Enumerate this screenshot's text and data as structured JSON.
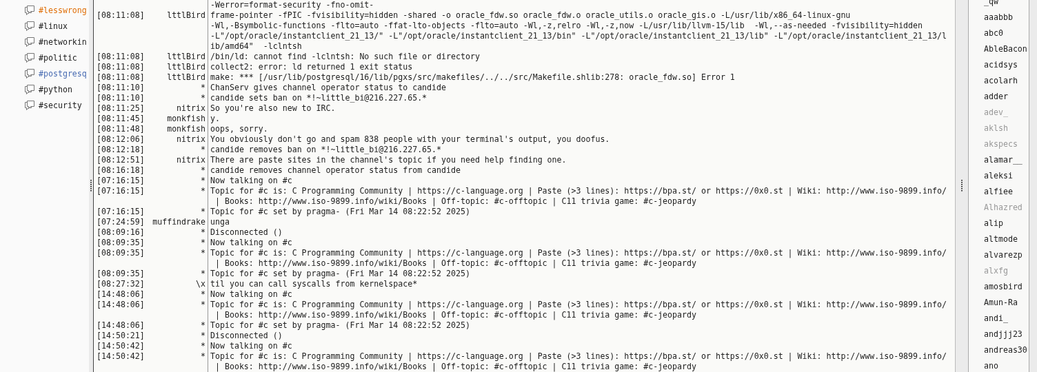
{
  "channels": [
    {
      "name": "#lesswrong",
      "color": "#e0700a"
    },
    {
      "name": "#linux",
      "color": "#222222"
    },
    {
      "name": "#networkin",
      "color": "#222222"
    },
    {
      "name": "#politic",
      "color": "#222222"
    },
    {
      "name": "#postgresq",
      "color": "#4a6db3"
    },
    {
      "name": "#python",
      "color": "#222222"
    },
    {
      "name": "#security",
      "color": "#222222"
    }
  ],
  "log": [
    {
      "lines": [
        "-Werror=format-security -fno-omit-"
      ]
    },
    {
      "time": "[08:11:08]",
      "nick": "lttlBird",
      "lines": [
        "frame-pointer -fPIC -fvisibility=hidden -shared -o oracle_fdw.so oracle_fdw.o oracle_utils.o oracle_gis.o -L/usr/lib/x86_64-linux-gnu",
        "-Wl,-Bsymbolic-functions -flto=auto -ffat-lto-objects -flto=auto -Wl,-z,relro -Wl,-z,now -L/usr/lib/llvm-15/lib  -Wl,--as-needed -fvisibility=hidden",
        "-L\"/opt/oracle/instantclient_21_13/\" -L\"/opt/oracle/instantclient_21_13/bin\" -L\"/opt/oracle/instantclient_21_13/lib\" -L\"/opt/oracle/instantclient_21_13/l",
        "ib/amd64\"  -lclntsh"
      ]
    },
    {
      "time": "[08:11:08]",
      "nick": "lttlBird",
      "lines": [
        "/bin/ld: cannot find -lclntsh: No such file or directory"
      ]
    },
    {
      "time": "[08:11:08]",
      "nick": "lttlBird",
      "lines": [
        "collect2: error: ld returned 1 exit status"
      ]
    },
    {
      "time": "[08:11:08]",
      "nick": "lttlBird",
      "lines": [
        "make: *** [/usr/lib/postgresql/16/lib/pgxs/src/makefiles/../../src/Makefile.shlib:278: oracle_fdw.so] Error 1"
      ]
    },
    {
      "time": "[08:11:10]",
      "nick": "*",
      "lines": [
        "ChanServ gives channel operator status to candide"
      ]
    },
    {
      "time": "[08:11:10]",
      "nick": "*",
      "lines": [
        "candide sets ban on *!~little_bi@216.227.65.*"
      ]
    },
    {
      "time": "[08:11:25]",
      "nick": "nitrix",
      "lines": [
        "So you're also new to IRC."
      ]
    },
    {
      "time": "[08:11:45]",
      "nick": "monkfish",
      "lines": [
        "y."
      ]
    },
    {
      "time": "[08:11:48]",
      "nick": "monkfish",
      "lines": [
        "oops, sorry."
      ]
    },
    {
      "time": "[08:12:06]",
      "nick": "nitrix",
      "lines": [
        "You obviously don't go and spam 838 people with your terminal's output, you doofus."
      ]
    },
    {
      "time": "[08:12:18]",
      "nick": "*",
      "lines": [
        "candide removes ban on *!~little_bi@216.227.65.*"
      ]
    },
    {
      "time": "[08:12:51]",
      "nick": "nitrix",
      "lines": [
        "There are paste sites in the channel's topic if you need help finding one."
      ]
    },
    {
      "time": "[08:16:18]",
      "nick": "*",
      "lines": [
        "candide removes channel operator status from candide"
      ]
    },
    {
      "time": "[07:16:15]",
      "nick": "*",
      "lines": [
        "Now talking on #c"
      ]
    },
    {
      "time": "[07:16:15]",
      "nick": "*",
      "lines": [
        "Topic for #c is: C Programming Community | https://c-language.org | Paste (>3 lines): https://bpa.st/ or https://0x0.st | Wiki: http://www.iso-9899.info/",
        " | Books: http://www.iso-9899.info/wiki/Books | Off-topic: #c-offtopic | C11 trivia game: #c-jeopardy"
      ]
    },
    {
      "time": "[07:16:15]",
      "nick": "*",
      "lines": [
        "Topic for #c set by pragma- (Fri Mar 14 08:22:52 2025)"
      ]
    },
    {
      "time": "[07:24:59]",
      "nick": "muffindrake",
      "lines": [
        "unga"
      ]
    },
    {
      "time": "[08:09:16]",
      "nick": "*",
      "lines": [
        "Disconnected ()"
      ]
    },
    {
      "time": "[08:09:35]",
      "nick": "*",
      "lines": [
        "Now talking on #c"
      ]
    },
    {
      "time": "[08:09:35]",
      "nick": "*",
      "lines": [
        "Topic for #c is: C Programming Community | https://c-language.org | Paste (>3 lines): https://bpa.st/ or https://0x0.st | Wiki: http://www.iso-9899.info/",
        " | Books: http://www.iso-9899.info/wiki/Books | Off-topic: #c-offtopic | C11 trivia game: #c-jeopardy"
      ]
    },
    {
      "time": "[08:09:35]",
      "nick": "*",
      "lines": [
        "Topic for #c set by pragma- (Fri Mar 14 08:22:52 2025)"
      ]
    },
    {
      "time": "[08:27:32]",
      "nick": "\\x",
      "lines": [
        "til you can call syscalls from kernelspace*"
      ]
    },
    {
      "time": "[14:48:06]",
      "nick": "*",
      "lines": [
        "Now talking on #c"
      ]
    },
    {
      "time": "[14:48:06]",
      "nick": "*",
      "lines": [
        "Topic for #c is: C Programming Community | https://c-language.org | Paste (>3 lines): https://bpa.st/ or https://0x0.st | Wiki: http://www.iso-9899.info/",
        " | Books: http://www.iso-9899.info/wiki/Books | Off-topic: #c-offtopic | C11 trivia game: #c-jeopardy"
      ]
    },
    {
      "time": "[14:48:06]",
      "nick": "*",
      "lines": [
        "Topic for #c set by pragma- (Fri Mar 14 08:22:52 2025)"
      ]
    },
    {
      "time": "[14:50:21]",
      "nick": "*",
      "lines": [
        "Disconnected ()"
      ]
    },
    {
      "time": "[14:50:42]",
      "nick": "*",
      "lines": [
        "Now talking on #c"
      ]
    },
    {
      "time": "[14:50:42]",
      "nick": "*",
      "lines": [
        "Topic for #c is: C Programming Community | https://c-language.org | Paste (>3 lines): https://bpa.st/ or https://0x0.st | Wiki: http://www.iso-9899.info/",
        " | Books: http://www.iso-9899.info/wiki/Books | Off-topic: #c-offtopic | C11 trivia game: #c-jeopardy"
      ]
    }
  ],
  "users": [
    {
      "nick": "_qw",
      "away": false
    },
    {
      "nick": "aaabbb",
      "away": false
    },
    {
      "nick": "abc0",
      "away": false
    },
    {
      "nick": "AbleBacon",
      "away": false
    },
    {
      "nick": "acidsys",
      "away": false
    },
    {
      "nick": "acolarh",
      "away": false
    },
    {
      "nick": "adder",
      "away": false
    },
    {
      "nick": "adev_",
      "away": true
    },
    {
      "nick": "aklsh",
      "away": true
    },
    {
      "nick": "akspecs",
      "away": true
    },
    {
      "nick": "alamar__",
      "away": false
    },
    {
      "nick": "aleksi",
      "away": false
    },
    {
      "nick": "alfiee",
      "away": false
    },
    {
      "nick": "Alhazred",
      "away": true
    },
    {
      "nick": "alip",
      "away": false
    },
    {
      "nick": "altmode",
      "away": false
    },
    {
      "nick": "alvarezp",
      "away": false
    },
    {
      "nick": "alxfg",
      "away": true
    },
    {
      "nick": "amosbird",
      "away": false
    },
    {
      "nick": "Amun-Ra",
      "away": false
    },
    {
      "nick": "andi_",
      "away": false
    },
    {
      "nick": "andjjj23",
      "away": false
    },
    {
      "nick": "andreas30",
      "away": false
    },
    {
      "nick": "ano",
      "away": false
    }
  ]
}
